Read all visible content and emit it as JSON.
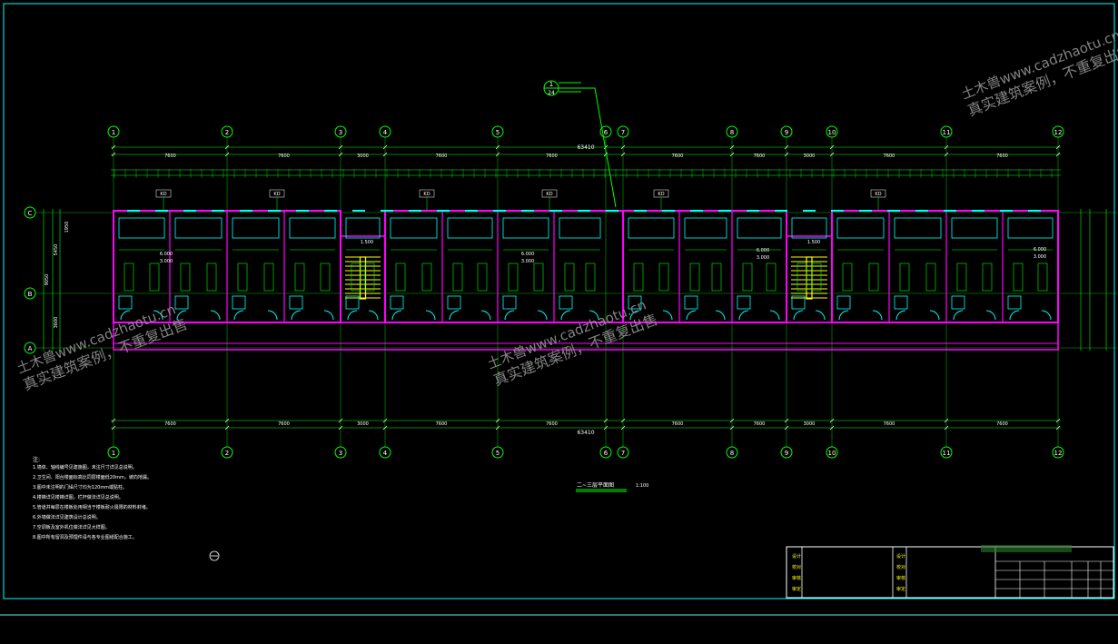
{
  "drawing": {
    "title": "二~三层平面图",
    "scale": "1:100",
    "overall_dimension": "63410",
    "section_mark": "1",
    "section_sheet": "24"
  },
  "axes_top": [
    "1",
    "2",
    "3",
    "4",
    "5",
    "6",
    "7",
    "8",
    "9",
    "10",
    "11",
    "12"
  ],
  "axes_bottom": [
    "1",
    "2",
    "3",
    "4",
    "5",
    "6",
    "7",
    "8",
    "9",
    "10",
    "11",
    "12"
  ],
  "axes_left": [
    "C",
    "B",
    "A"
  ],
  "bay_dimensions": [
    "7600",
    "7600",
    "3000",
    "7600",
    "7600",
    "7600",
    "7600",
    "3000",
    "7600",
    "7600"
  ],
  "left_dimensions": [
    "5450",
    "1950",
    "9050",
    "3600"
  ],
  "door_labels": [
    "KD",
    "KD",
    "KD",
    "KD",
    "KD",
    "KD"
  ],
  "level_labels": [
    "1.500",
    "6.000",
    "3.000",
    "6.000",
    "3.000",
    "1.500",
    "6.000",
    "3.000",
    "6.000",
    "3.000"
  ],
  "notes": {
    "heading": "注:",
    "lines": [
      "1.墙体、轴线编号见建施图，未注尺寸详见总说明。",
      "2.卫生间、阳台楼面标高比同层楼面低20mm，坡向地漏。",
      "3.图中未注明的门垛尺寸均为120mm或贴柱。",
      "4.楼梯详见楼梯详图，栏杆做法详见总说明。",
      "5.管道井每层在楼板处用相当于楼板耐火极限的材料封堵。",
      "6.外墙做法详见建筑设计总说明。",
      "7.空调板及室外机位做法详见大样图。",
      "8.图中所有留洞及预埋件请与各专业图纸配合施工。"
    ]
  },
  "title_block": {
    "cells": [
      "设计",
      "校对",
      "审核",
      "审定"
    ]
  },
  "watermark": {
    "line1": "土木兽www.cadzhaotu.cn",
    "line2": "真实建筑案例，不重复出售"
  },
  "colors": {
    "background": "#000000",
    "axis": "#00ff00",
    "wall": "#ff00ff",
    "window": "#00ffff",
    "stair": "#ffff00",
    "text": "#ffffff",
    "dim": "#00ff00"
  }
}
